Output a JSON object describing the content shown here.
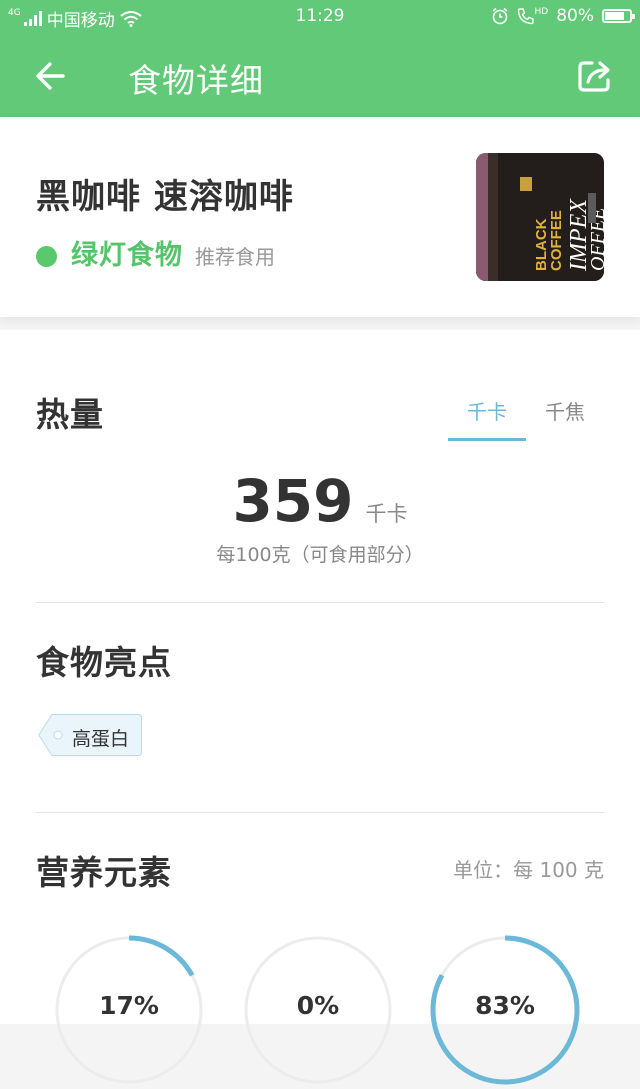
{
  "status_bar": {
    "network": "4G",
    "carrier": "中国移动",
    "time": "11:29",
    "hd_label": "HD",
    "battery_text": "80%",
    "battery_level": 0.8
  },
  "nav": {
    "back_icon": "arrow-left-icon",
    "title": "食物详细",
    "share_icon": "share-icon"
  },
  "food": {
    "name": "黑咖啡 速溶咖啡",
    "light_label": "绿灯食物",
    "light_note": "推荐食用",
    "light_color": "#5ac86e"
  },
  "calories": {
    "title": "热量",
    "unit_tabs": [
      "千卡",
      "千焦"
    ],
    "active_unit": "千卡",
    "value": "359",
    "unit": "千卡",
    "note": "每100克（可食用部分）"
  },
  "highlights": {
    "title": "食物亮点",
    "tags": [
      "高蛋白"
    ]
  },
  "nutrients": {
    "title": "营养元素",
    "unit_note": "单位：每 100 克",
    "rings": [
      {
        "percent_label": "17%",
        "fraction": 0.17
      },
      {
        "percent_label": "0%",
        "fraction": 0.0
      },
      {
        "percent_label": "83%",
        "fraction": 0.83
      }
    ]
  },
  "colors": {
    "header_green": "#62c978",
    "accent_blue": "#6bb8d8",
    "green_text": "#55c46b"
  }
}
